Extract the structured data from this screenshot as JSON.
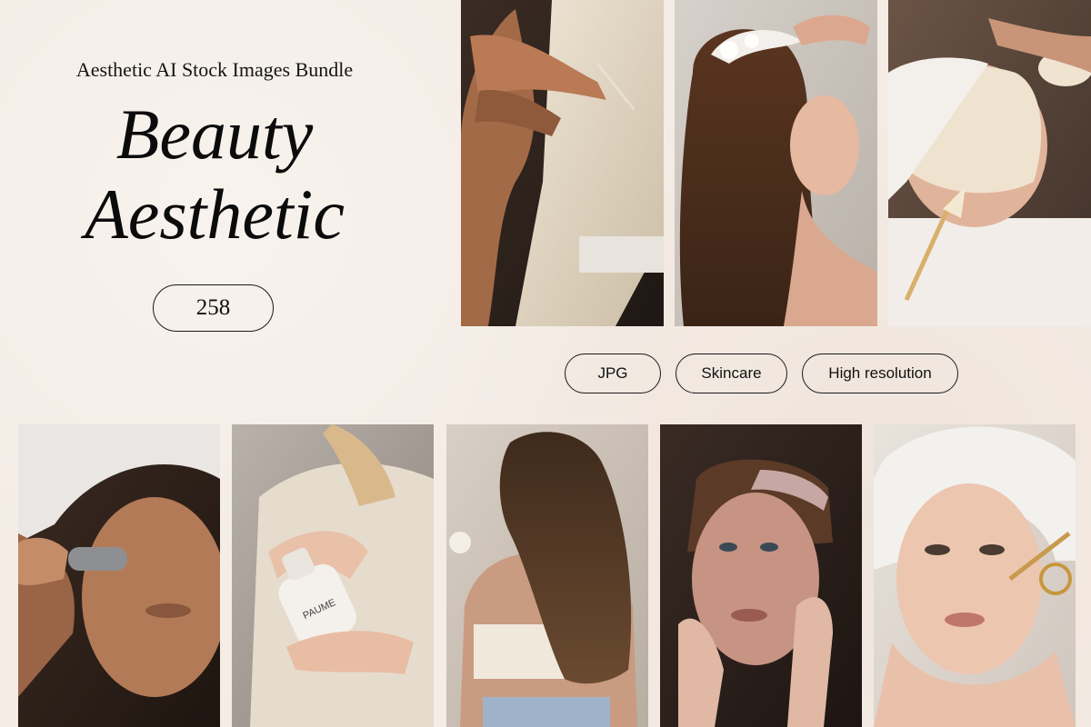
{
  "header": {
    "subtitle": "Aesthetic AI Stock Images Bundle",
    "title_line1": "Beauty",
    "title_line2": "Aesthetic"
  },
  "count": "258",
  "tags": [
    "JPG",
    "Skincare",
    "High resolution"
  ],
  "photos": {
    "top": [
      {
        "name": "legs-robe-photo"
      },
      {
        "name": "hair-wash-photo"
      },
      {
        "name": "face-mask-brush-photo"
      }
    ],
    "bottom": [
      {
        "name": "facial-device-photo"
      },
      {
        "name": "serum-bottle-photo",
        "bottle_label": "PAUME"
      },
      {
        "name": "curly-hair-back-photo"
      },
      {
        "name": "clay-mask-photo"
      },
      {
        "name": "dropper-serum-photo"
      }
    ]
  },
  "colors": {
    "background": "#f4ece5",
    "text": "#0b0b0b"
  }
}
